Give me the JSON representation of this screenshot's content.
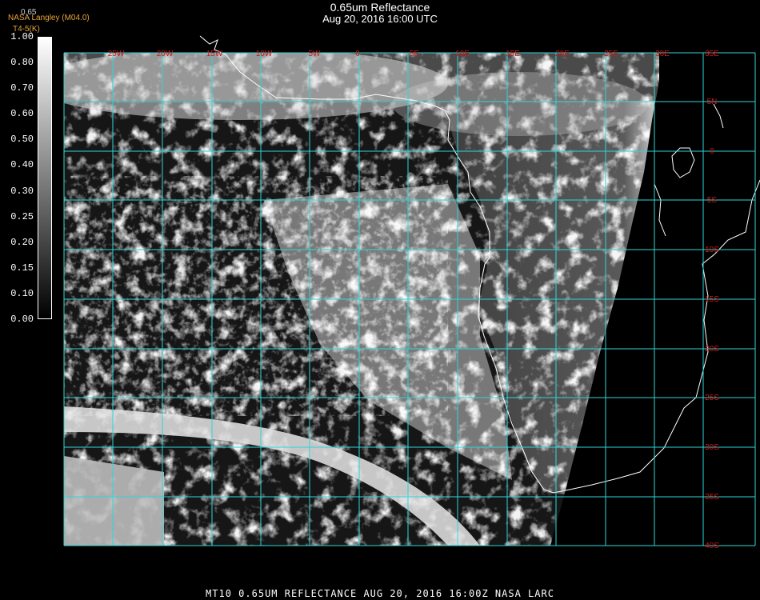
{
  "header": {
    "title": "0.65um Reflectance",
    "datetime": "Aug 20, 2016 16:00 UTC"
  },
  "producer": {
    "name": "NASA Langley (M04.0)",
    "product": "T4-5(K)",
    "cb_top": "0.65"
  },
  "colorbar": {
    "labels": [
      "1.00",
      "0.80",
      "0.70",
      "0.60",
      "0.50",
      "0.40",
      "0.30",
      "0.25",
      "0.20",
      "0.15",
      "0.10",
      "0.00"
    ]
  },
  "grid": {
    "lon_labels": [
      "25W",
      "20W",
      "15W",
      "10W",
      "5W",
      "0",
      "5E",
      "10E",
      "15E",
      "20E",
      "25E",
      "30E",
      "35E"
    ],
    "lat_labels": [
      "5N",
      "0",
      "5S",
      "10S",
      "15S",
      "20S",
      "25S",
      "30S",
      "35S",
      "40S"
    ]
  },
  "footer": {
    "text": "MT10  0.65UM REFLECTANCE   AUG 20, 2016 16:00Z   NASA LARC"
  },
  "colors": {
    "grid": "#2fd6d6",
    "label": "#d01818",
    "coast": "#ffffff",
    "org": "#e8a33a"
  }
}
